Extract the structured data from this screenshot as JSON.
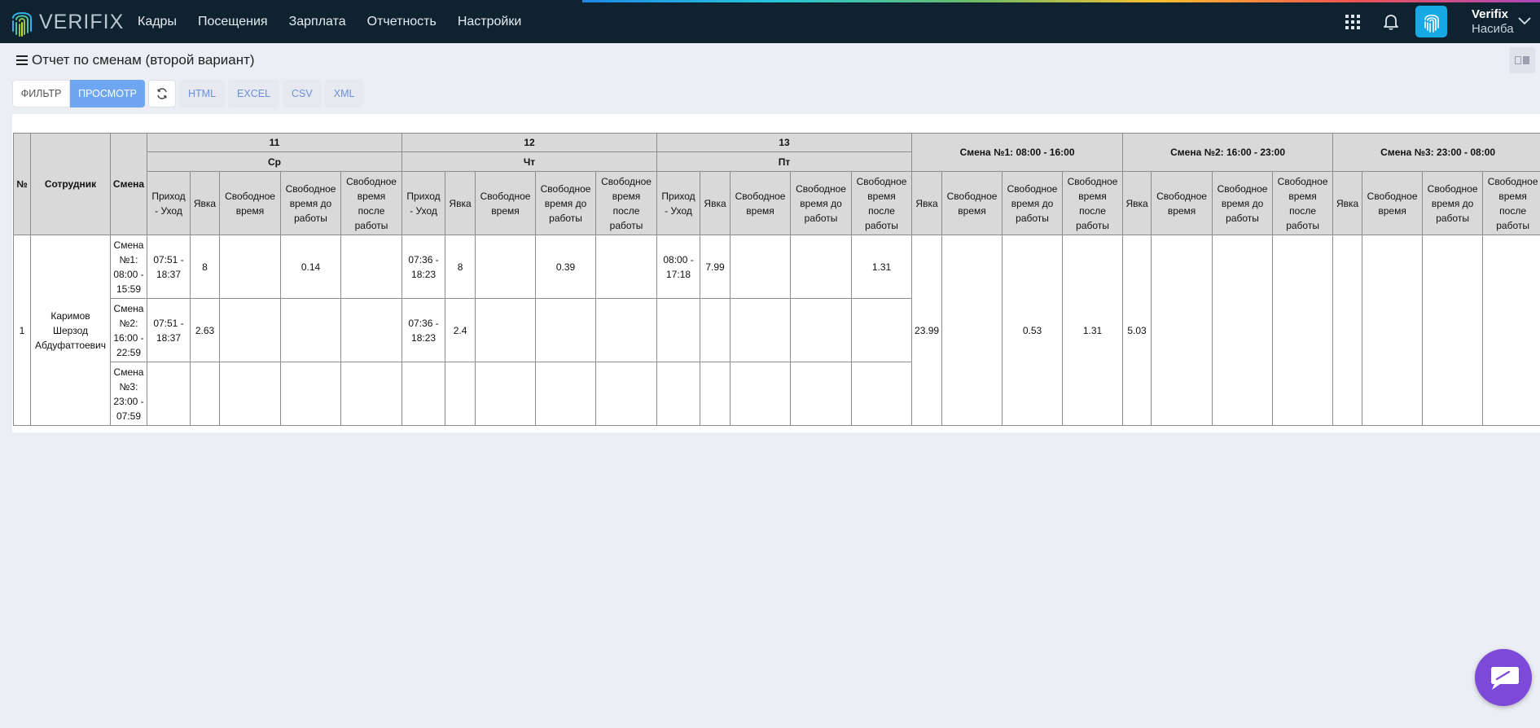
{
  "app": {
    "logo_text": "VERIFIX"
  },
  "nav": {
    "items": [
      "Кадры",
      "Посещения",
      "Зарплата",
      "Отчетность",
      "Настройки"
    ]
  },
  "user": {
    "name": "Verifix",
    "sub": "Насиба"
  },
  "page": {
    "title": "Отчет по сменам (второй вариант)"
  },
  "toolbar": {
    "filter": "ФИЛЬТР",
    "view": "ПРОСМОТР",
    "exports": [
      "HTML",
      "EXCEL",
      "CSV",
      "XML"
    ]
  },
  "report": {
    "headers": {
      "no": "№",
      "employee": "Сотрудник",
      "shift": "Смена",
      "days": [
        {
          "num": "11",
          "weekday": "Ср"
        },
        {
          "num": "12",
          "weekday": "Чт"
        },
        {
          "num": "13",
          "weekday": "Пт"
        }
      ],
      "day_cols": [
        "Приход - Уход",
        "Явка",
        "Свободное время",
        "Свободное время до работы",
        "Свободное время после работы"
      ],
      "shift_groups": [
        "Смена №1: 08:00 - 16:00",
        "Смена №2: 16:00 - 23:00",
        "Смена №3: 23:00 - 08:00"
      ],
      "summary_cols": [
        "Явка",
        "Свободное время",
        "Свободное время до работы",
        "Свободное время после работы"
      ]
    },
    "employee": {
      "no": "1",
      "name": "Каримов Шерзод Абдуфаттоевич"
    },
    "rows": [
      {
        "shift": "Смена №1: 08:00 - 15:59",
        "days": [
          [
            "07:51 - 18:37",
            "8",
            "",
            "0.14",
            ""
          ],
          [
            "07:36 - 18:23",
            "8",
            "",
            "0.39",
            ""
          ],
          [
            "08:00 - 17:18",
            "7.99",
            "",
            "",
            "1.31"
          ]
        ]
      },
      {
        "shift": "Смена №2: 16:00 - 22:59",
        "days": [
          [
            "07:51 - 18:37",
            "2.63",
            "",
            "",
            ""
          ],
          [
            "07:36 - 18:23",
            "2.4",
            "",
            "",
            ""
          ],
          [
            "",
            "",
            "",
            "",
            ""
          ]
        ]
      },
      {
        "shift": "Смена №3: 23:00 - 07:59",
        "days": [
          [
            "",
            "",
            "",
            "",
            ""
          ],
          [
            "",
            "",
            "",
            "",
            ""
          ],
          [
            "",
            "",
            "",
            "",
            ""
          ]
        ]
      }
    ],
    "summary": [
      [
        "23.99",
        "",
        "0.53",
        "1.31"
      ],
      [
        "5.03",
        "",
        "",
        ""
      ],
      [
        "",
        "",
        "",
        ""
      ]
    ]
  }
}
